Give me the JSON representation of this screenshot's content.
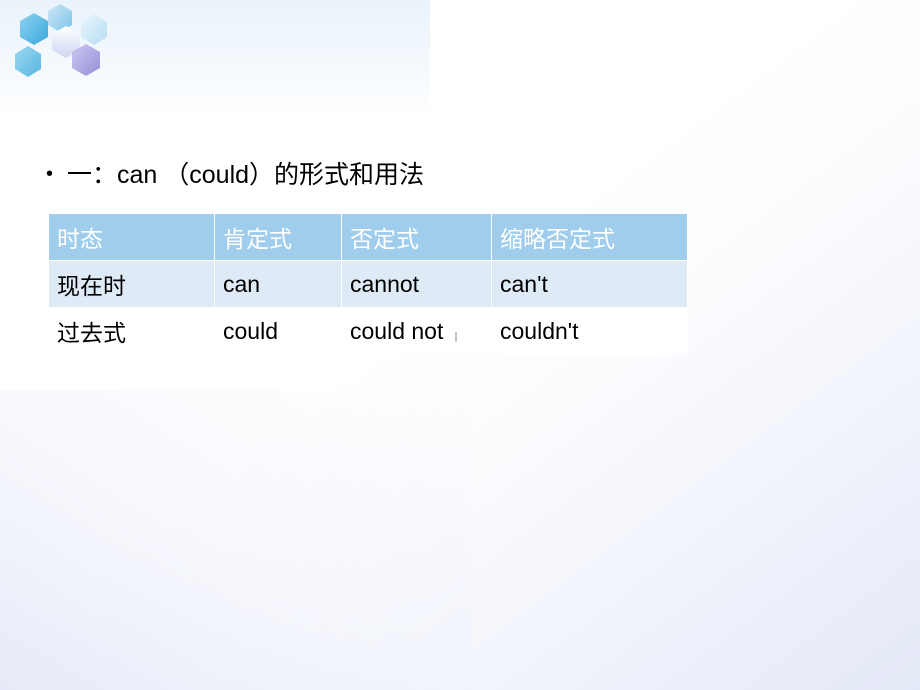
{
  "slide": {
    "bullet_marker": "•",
    "heading": "一：can （could）的形式和用法",
    "decor_icon": "hexagon-cluster-logo",
    "colors": {
      "header_bg": "#9fcdeb",
      "row_alt_bg": "#deeaf6",
      "text": "#000000",
      "header_text": "#ffffff"
    }
  },
  "table": {
    "headers": [
      "时态",
      "肯定式",
      "否定式",
      "缩略否定式"
    ],
    "rows": [
      [
        "现在时",
        "can",
        "cannot",
        "can't"
      ],
      [
        "过去式",
        "could",
        "could not",
        "couldn't"
      ]
    ]
  }
}
